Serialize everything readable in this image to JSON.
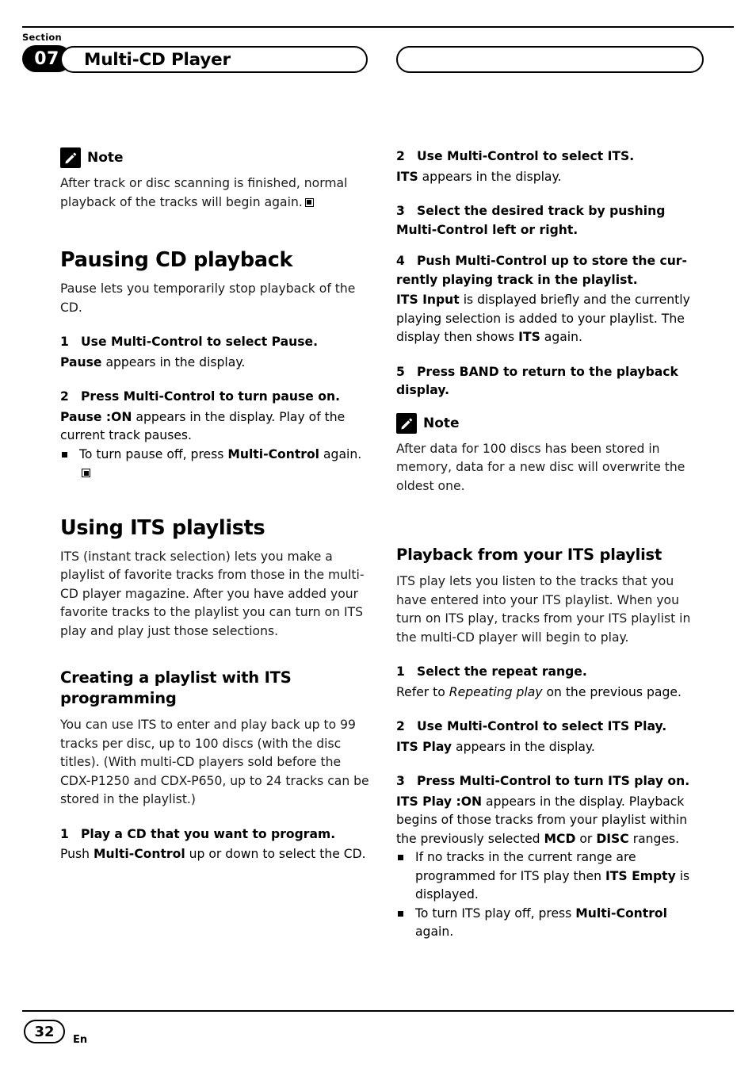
{
  "header": {
    "section_word": "Section",
    "section_number": "07",
    "title": "Multi-CD Player"
  },
  "footer": {
    "page_number": "32",
    "language": "En"
  },
  "left_column": {
    "note1": {
      "label": "Note",
      "text": "After track or disc scanning is finished, normal playback of the tracks will begin again."
    },
    "heading_pausing": "Pausing CD playback",
    "pausing_intro": "Pause lets you temporarily stop playback of the CD.",
    "step1_title_num": "1",
    "step1_title": "Use Multi-Control to select Pause.",
    "step1_body_bold": "Pause",
    "step1_body_rest": " appears in the display.",
    "step2_title_num": "2",
    "step2_title": "Press Multi-Control to turn pause on.",
    "step2_body_bold": "Pause :ON",
    "step2_body_rest": " appears in the display. Play of the current track pauses.",
    "step2_bullet_pre": "To turn pause off, press ",
    "step2_bullet_bold": "Multi-Control",
    "step2_bullet_post": " again.",
    "heading_its": "Using ITS playlists",
    "its_intro": "ITS (instant track selection) lets you make a playlist of favorite tracks from those in the multi-CD player magazine. After you have added your favorite tracks to the playlist you can turn on ITS play and play just those selections.",
    "subheading_creating_line1": "Creating a playlist with ITS",
    "subheading_creating_line2": "programming",
    "creating_intro": "You can use ITS to enter and play back up to 99 tracks per disc, up to 100 discs (with the disc titles). (With multi-CD players sold before the CDX-P1250 and CDX-P650, up to 24 tracks can be stored in the playlist.)",
    "creating_step1_num": "1",
    "creating_step1_title": "Play a CD that you want to program.",
    "creating_step1_body_pre": "Push ",
    "creating_step1_body_bold": "Multi-Control",
    "creating_step1_body_post": " up or down to select the CD."
  },
  "right_column": {
    "step2_num": "2",
    "step2_title": "Use Multi-Control to select ITS.",
    "step2_body_bold": "ITS",
    "step2_body_rest": " appears in the display.",
    "step3_num": "3",
    "step3_title_line1": "Select the desired track by pushing",
    "step3_title_line2": "Multi-Control left or right.",
    "step4_num": "4",
    "step4_title_line1": "Push Multi-Control up to store the cur-",
    "step4_title_line2": "rently playing track in the playlist.",
    "step4_body_bold1": "ITS Input",
    "step4_body_mid": " is displayed briefly and the currently playing selection is added to your playlist. The display then shows ",
    "step4_body_bold2": "ITS",
    "step4_body_post": " again.",
    "step5_num": "5",
    "step5_title_line1": "Press BAND to return to the playback",
    "step5_title_line2": "display.",
    "note2": {
      "label": "Note",
      "text": "After data for 100 discs has been stored in memory, data for a new disc will overwrite the oldest one."
    },
    "subheading_playback": "Playback from your ITS playlist",
    "playback_intro": "ITS play lets you listen to the tracks that you have entered into your ITS playlist. When you turn on ITS play, tracks from your ITS playlist in the multi-CD player will begin to play.",
    "pb_step1_num": "1",
    "pb_step1_title": "Select the repeat range.",
    "pb_step1_body_pre": "Refer to ",
    "pb_step1_body_italic": "Repeating play",
    "pb_step1_body_post": " on the previous page.",
    "pb_step2_num": "2",
    "pb_step2_title": "Use Multi-Control to select ITS Play.",
    "pb_step2_body_bold": "ITS Play",
    "pb_step2_body_rest": " appears in the display.",
    "pb_step3_num": "3",
    "pb_step3_title": "Press Multi-Control to turn ITS play on.",
    "pb_step3_body_bold": "ITS Play :ON",
    "pb_step3_body_mid": " appears in the display. Playback begins of those tracks from your playlist within the previously selected ",
    "pb_step3_body_bold2": "MCD",
    "pb_step3_body_or": " or ",
    "pb_step3_body_bold3": "DISC",
    "pb_step3_body_post": " ranges.",
    "pb_bullet1_pre": "If no tracks in the current range are programmed for ITS play then ",
    "pb_bullet1_bold": "ITS Empty",
    "pb_bullet1_post": " is displayed.",
    "pb_bullet2_pre": "To turn ITS play off, press ",
    "pb_bullet2_bold": "Multi-Control",
    "pb_bullet2_post": " again."
  }
}
